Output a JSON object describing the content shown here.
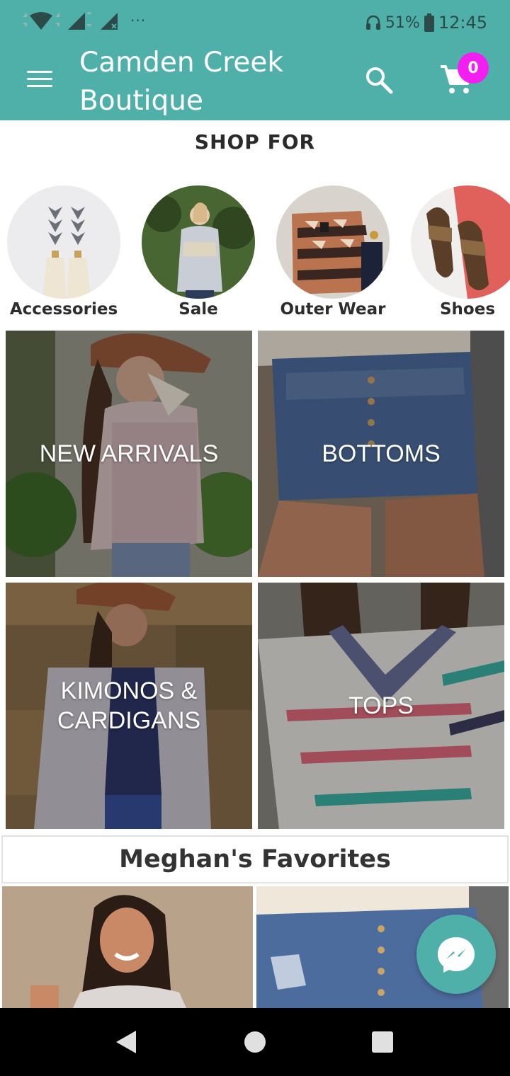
{
  "status_bar": {
    "battery": "51%",
    "time": "12:45",
    "more": "···"
  },
  "header": {
    "title": "Camden Creek Boutique",
    "cart_count": "0",
    "background": "#4fb0aa",
    "badge_color": "#f21ff0"
  },
  "shop_for": {
    "title": "SHOP FOR",
    "categories": [
      {
        "label": "Accessories"
      },
      {
        "label": "Sale"
      },
      {
        "label": "Outer Wear"
      },
      {
        "label": "Shoes"
      }
    ]
  },
  "tiles": [
    {
      "label": "NEW ARRIVALS"
    },
    {
      "label": "BOTTOMS"
    },
    {
      "label": "KIMONOS & CARDIGANS"
    },
    {
      "label": "TOPS"
    }
  ],
  "favorites": {
    "title": "Meghan's Favorites"
  },
  "icons": {
    "menu": "menu-icon",
    "search": "search-icon",
    "cart": "cart-icon",
    "messenger": "messenger-icon",
    "back": "back-icon",
    "home": "home-icon",
    "recents": "recents-icon"
  }
}
